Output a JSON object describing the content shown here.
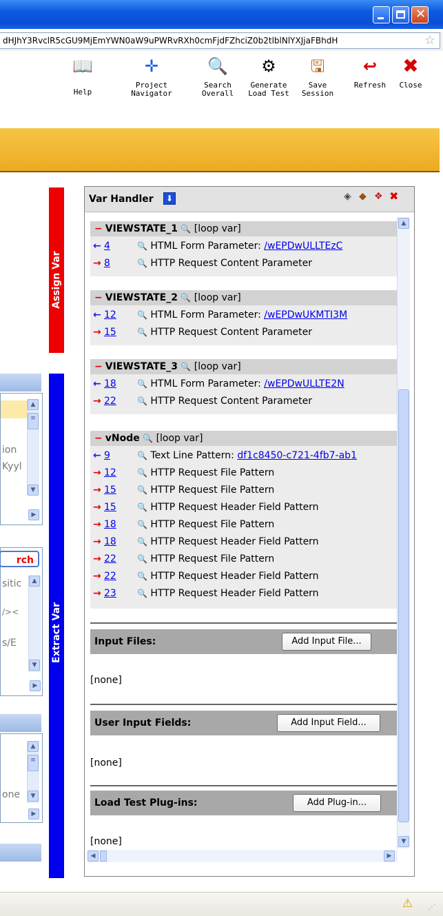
{
  "address": {
    "url_fragment": "dHJhY3RvclR5cGU9MjEmYWN0aW9uPWRvRXh0cmFjdFZhciZ0b2tlblNlYXJjaFBhdH"
  },
  "toolbar": {
    "help": "Help",
    "project_navigator_1": "Project",
    "project_navigator_2": "Navigator",
    "search_overall_1": "Search",
    "search_overall_2": "Overall",
    "generate_1": "Generate",
    "generate_2": "Load Test",
    "save_1": "Save",
    "save_2": "Session",
    "refresh": "Refresh",
    "close": "Close"
  },
  "tabs": {
    "assign": "Assign Var",
    "extract": "Extract Var"
  },
  "left": {
    "text1": "ion",
    "text2": "Kyyl",
    "btn": "rch",
    "text3": "sitic",
    "text4": "/><",
    "text5": "s/E",
    "text6": "one"
  },
  "panel": {
    "title": "Var Handler",
    "groups": [
      {
        "name": "VIEWSTATE_1",
        "tag": "[loop var]",
        "rows": [
          {
            "dir": "in",
            "num": "4",
            "label": "HTML Form Parameter: ",
            "link": "/wEPDwULLTEzC"
          },
          {
            "dir": "out",
            "num": "8",
            "label": "HTTP Request Content Parameter",
            "link": ""
          }
        ]
      },
      {
        "name": "VIEWSTATE_2",
        "tag": "[loop var]",
        "rows": [
          {
            "dir": "in",
            "num": "12",
            "label": "HTML Form Parameter: ",
            "link": "/wEPDwUKMTI3M"
          },
          {
            "dir": "out",
            "num": "15",
            "label": "HTTP Request Content Parameter",
            "link": ""
          }
        ]
      },
      {
        "name": "VIEWSTATE_3",
        "tag": "[loop var]",
        "rows": [
          {
            "dir": "in",
            "num": "18",
            "label": "HTML Form Parameter: ",
            "link": "/wEPDwULLTE2N"
          },
          {
            "dir": "out",
            "num": "22",
            "label": "HTTP Request Content Parameter",
            "link": ""
          }
        ]
      },
      {
        "name": "vNode",
        "tag": "[loop var]",
        "rows": [
          {
            "dir": "in",
            "num": "9",
            "label": "Text Line Pattern: ",
            "link": "df1c8450-c721-4fb7-ab1"
          },
          {
            "dir": "out",
            "num": "12",
            "label": "HTTP Request File Pattern",
            "link": ""
          },
          {
            "dir": "out",
            "num": "15",
            "label": "HTTP Request File Pattern",
            "link": ""
          },
          {
            "dir": "out",
            "num": "15",
            "label": "HTTP Request Header Field Pattern",
            "link": ""
          },
          {
            "dir": "out",
            "num": "18",
            "label": "HTTP Request File Pattern",
            "link": ""
          },
          {
            "dir": "out",
            "num": "18",
            "label": "HTTP Request Header Field Pattern",
            "link": ""
          },
          {
            "dir": "out",
            "num": "22",
            "label": "HTTP Request File Pattern",
            "link": ""
          },
          {
            "dir": "out",
            "num": "22",
            "label": "HTTP Request Header Field Pattern",
            "link": ""
          },
          {
            "dir": "out",
            "num": "23",
            "label": "HTTP Request Header Field Pattern",
            "link": ""
          }
        ]
      }
    ],
    "input_files": {
      "label": "Input Files:",
      "button": "Add Input File...",
      "value": "[none]"
    },
    "user_input": {
      "label": "User Input Fields:",
      "button": "Add Input Field...",
      "value": "[none]"
    },
    "plugins": {
      "label": "Load Test Plug-ins:",
      "button": "Add Plug-in...",
      "value": "[none]"
    }
  }
}
